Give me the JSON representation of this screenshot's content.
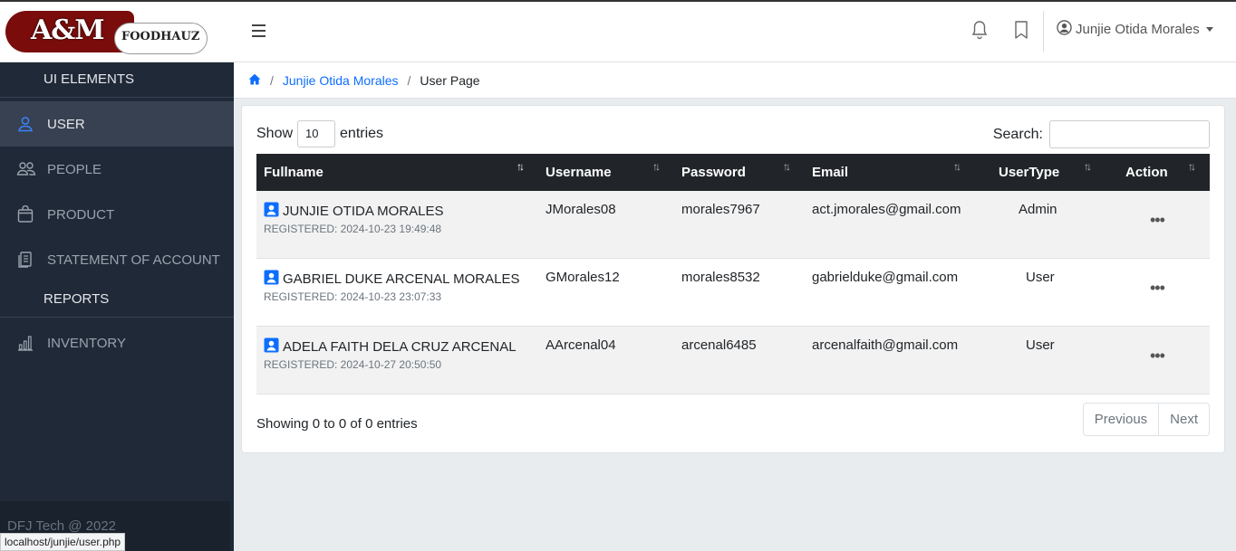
{
  "brand": {
    "title": "A&M",
    "subtitle": "FOODHAUZ"
  },
  "header": {
    "user_name": "Junjie Otida Morales"
  },
  "sidebar": {
    "heading": "UI ELEMENTS",
    "items": [
      {
        "label": "USER",
        "icon": "user-icon",
        "active": true
      },
      {
        "label": "PEOPLE",
        "icon": "people-icon"
      },
      {
        "label": "PRODUCT",
        "icon": "bag-icon"
      },
      {
        "label": "STATEMENT OF ACCOUNT",
        "icon": "documents-icon"
      }
    ],
    "reports_heading": "REPORTS",
    "inventory": {
      "label": "INVENTORY",
      "icon": "bar-chart-icon"
    },
    "footer": "DFJ Tech @ 2022"
  },
  "breadcrumb": {
    "home_icon": "home-icon",
    "link": "Junjie Otida Morales",
    "current": "User Page"
  },
  "table_controls": {
    "show_label": "Show",
    "entries_value": "10",
    "entries_label": "entries",
    "search_label": "Search:"
  },
  "table": {
    "columns": [
      "Fullname",
      "Username",
      "Password",
      "Email",
      "UserType",
      "Action"
    ],
    "rows": [
      {
        "fullname": "JUNJIE OTIDA MORALES",
        "registered": "REGISTERED: 2024-10-23 19:49:48",
        "username": "JMorales08",
        "password": "morales7967",
        "email": "act.jmorales@gmail.com",
        "usertype": "Admin"
      },
      {
        "fullname": "GABRIEL DUKE ARCENAL MORALES",
        "registered": "REGISTERED: 2024-10-23 23:07:33",
        "username": "GMorales12",
        "password": "morales8532",
        "email": "gabrielduke@gmail.com",
        "usertype": "User"
      },
      {
        "fullname": "ADELA FAITH DELA CRUZ ARCENAL",
        "registered": "REGISTERED: 2024-10-27 20:50:50",
        "username": "AArcenal04",
        "password": "arcenal6485",
        "email": "arcenalfaith@gmail.com",
        "usertype": "User"
      }
    ]
  },
  "info": "Showing 0 to 0 of 0 entries",
  "pagination": {
    "previous": "Previous",
    "next": "Next"
  },
  "status_bar": "localhost/junjie/user.php",
  "colors": {
    "sidebar": "#1f2937",
    "accent": "#0d6efd",
    "table_header": "#212529",
    "brand_red": "#7a0c0c"
  }
}
